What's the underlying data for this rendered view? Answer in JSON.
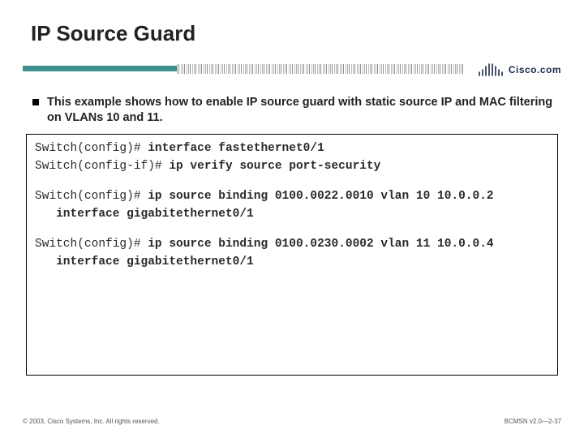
{
  "title": "IP Source Guard",
  "logo_text": "Cisco.com",
  "bullet": "This example shows how to enable IP source guard with static source IP and MAC filtering on VLANs 10 and 11.",
  "console": {
    "l0_prompt": "Switch(config)# ",
    "l0_cmd": "interface fastethernet0/1",
    "l1_prompt": "Switch(config-if)# ",
    "l1_cmd": "ip verify source port-security",
    "l2_prompt": "Switch(config)# ",
    "l2_cmd": "ip source binding 0100.0022.0010 vlan 10 10.0.0.2",
    "l2_cont": "   interface gigabitethernet0/1",
    "l3_prompt": "Switch(config)# ",
    "l3_cmd": "ip source binding 0100.0230.0002 vlan 11 10.0.0.4",
    "l3_cont": "   interface gigabitethernet0/1"
  },
  "footer": {
    "left": "© 2003, Cisco Systems, Inc. All rights reserved.",
    "right": "BCMSN v2.0—2-37"
  }
}
